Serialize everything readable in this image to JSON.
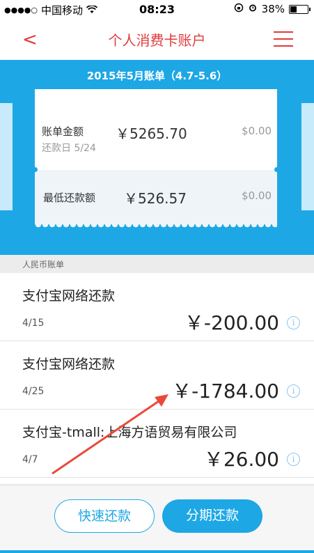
{
  "status_bar": {
    "signal_dots": "●●●●○",
    "carrier": "中国移动",
    "wifi_icon": "wifi-icon",
    "time": "08:23",
    "lock_icon": "rotation-lock-icon",
    "alarm_icon": "alarm-icon",
    "battery": "38%",
    "battery_level": 0.38
  },
  "nav": {
    "back_icon": "back-chevron-icon",
    "back_glyph": "<",
    "title": "个人消费卡账户",
    "menu_icon": "menu-icon",
    "accent_color": "#e03a3a"
  },
  "bill": {
    "title": "2015年5月账单（4.7-5.6）",
    "bg_color": "#1ea7e5",
    "amount_label": "账单金额",
    "amount": "￥5265.70",
    "amount_paid": "$0.00",
    "due_label": "还款日",
    "due_date": "5/24",
    "min_label": "最低还款额",
    "min_amount": "￥526.57",
    "min_paid": "$0.00"
  },
  "section": {
    "header": "人民币账单"
  },
  "transactions": [
    {
      "name": "支付宝网络还款",
      "date": "4/15",
      "amount": "￥-200.00",
      "info": "i"
    },
    {
      "name": "支付宝网络还款",
      "date": "4/25",
      "amount": "￥-1784.00",
      "info": "i"
    },
    {
      "name": "支付宝-tmall:上海方语贸易有限公司",
      "date": "4/7",
      "amount": "￥26.00",
      "info": "i"
    }
  ],
  "actions": {
    "quick_pay": "快速还款",
    "installment": "分期还款"
  }
}
